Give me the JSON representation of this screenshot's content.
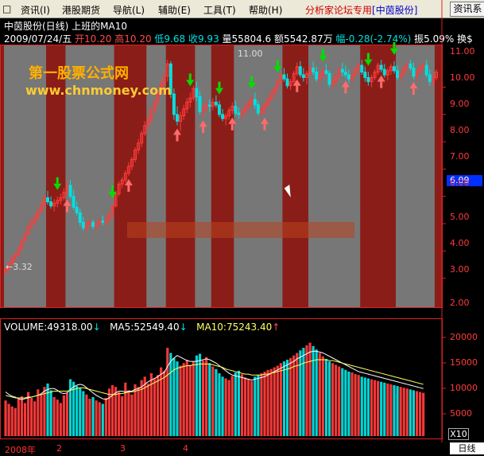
{
  "menu": {
    "items": [
      {
        "label": "资讯(I)"
      },
      {
        "label": "港股期货"
      },
      {
        "label": "导航(L)"
      },
      {
        "label": "辅助(E)"
      },
      {
        "label": "工具(T)"
      },
      {
        "label": "帮助(H)"
      }
    ],
    "promo_prefix": "分析家论坛专用",
    "promo_name": "[中茵股份]",
    "button": "资讯系"
  },
  "header": {
    "title": "中茵股份(日线) 上班的MA10",
    "date": "2009/07/24/五",
    "open_label": "开10.20",
    "high_label": "高10.20",
    "low_label": "低9.68",
    "close_label": "收9.93",
    "volume_label": "量55804.6",
    "amount_label": "额5542.87万",
    "change_label": "幅-0.28(-2.74%)",
    "amp_label": "振5.09%",
    "turnover_label": "换$"
  },
  "watermark": {
    "title": "第一股票公式网",
    "url": "www.chnmoney.com"
  },
  "annotations": {
    "low": "←3.32",
    "high": "11.00"
  },
  "price_axis": {
    "labels": [
      "11.00",
      "10.00",
      "9.00",
      "8.00",
      "7.00",
      "6.00",
      "5.00",
      "4.00",
      "3.00",
      "2.00"
    ],
    "current": "6.09"
  },
  "volume_axis": {
    "labels": [
      "20000",
      "15000",
      "10000",
      "5000"
    ],
    "multiplier": "X10"
  },
  "volume_legend": {
    "volume": "VOLUME:49318.00",
    "ma5": "MA5:52549.40",
    "ma10": "MA10:75243.40"
  },
  "x_axis": {
    "labels": [
      "2008年",
      "2",
      "3",
      "4"
    ]
  },
  "tab_label": "日线",
  "colors": {
    "up": "#ff3b3b",
    "down": "#00e0e0",
    "background": "#000000",
    "panel_red": "#8b1d18",
    "panel_gray": "#777777",
    "ma10": "#ffff66",
    "ma5": "#ffffff"
  },
  "chart_data": {
    "type": "candlestick",
    "price_range": [
      2.0,
      11.5
    ],
    "shaded_ranges": [
      {
        "start": 0,
        "end": 13
      },
      {
        "start": 19,
        "end": 34
      },
      {
        "start": 44,
        "end": 50
      },
      {
        "start": 59,
        "end": 64
      },
      {
        "start": 71,
        "end": 86
      },
      {
        "start": 94,
        "end": 110
      },
      {
        "start": 121,
        "end": 133
      }
    ],
    "candles": [
      [
        3.2,
        3.4,
        3.15,
        3.35
      ],
      [
        3.35,
        3.6,
        3.3,
        3.55
      ],
      [
        3.55,
        3.8,
        3.45,
        3.75
      ],
      [
        3.75,
        3.95,
        3.6,
        3.85
      ],
      [
        3.85,
        4.2,
        3.8,
        4.1
      ],
      [
        4.1,
        4.45,
        4.05,
        4.4
      ],
      [
        4.4,
        4.7,
        4.3,
        4.6
      ],
      [
        4.6,
        4.95,
        4.55,
        4.9
      ],
      [
        4.9,
        5.2,
        4.8,
        5.05
      ],
      [
        5.05,
        5.35,
        4.95,
        5.25
      ],
      [
        5.25,
        5.55,
        5.1,
        5.45
      ],
      [
        5.45,
        5.8,
        5.35,
        5.7
      ],
      [
        5.7,
        6.1,
        5.55,
        5.95
      ],
      [
        5.95,
        6.2,
        5.7,
        5.8
      ],
      [
        5.8,
        6.0,
        5.55,
        5.65
      ],
      [
        5.65,
        5.9,
        5.45,
        5.75
      ],
      [
        5.75,
        6.0,
        5.6,
        5.85
      ],
      [
        5.85,
        6.1,
        5.7,
        5.95
      ],
      [
        5.95,
        6.3,
        5.85,
        6.15
      ],
      [
        6.15,
        6.55,
        6.0,
        6.4
      ],
      [
        6.4,
        6.6,
        5.9,
        6.0
      ],
      [
        6.0,
        6.25,
        5.5,
        5.6
      ],
      [
        5.6,
        5.8,
        5.3,
        5.4
      ],
      [
        5.4,
        5.55,
        4.9,
        5.05
      ],
      [
        5.05,
        5.25,
        4.75,
        4.85
      ],
      [
        4.85,
        5.1,
        4.7,
        5.0
      ],
      [
        5.0,
        5.2,
        4.85,
        5.05
      ],
      [
        5.05,
        5.15,
        4.8,
        4.9
      ],
      [
        4.9,
        5.1,
        4.7,
        5.0
      ],
      [
        5.0,
        5.2,
        4.9,
        5.1
      ],
      [
        5.1,
        5.3,
        4.95,
        5.05
      ],
      [
        5.05,
        5.25,
        4.9,
        5.15
      ],
      [
        5.15,
        5.45,
        5.05,
        5.35
      ],
      [
        5.35,
        5.7,
        5.25,
        5.65
      ],
      [
        5.65,
        6.2,
        5.6,
        6.1
      ],
      [
        6.1,
        6.55,
        6.0,
        6.45
      ],
      [
        6.45,
        6.7,
        6.3,
        6.6
      ],
      [
        6.6,
        6.95,
        6.5,
        6.85
      ],
      [
        6.85,
        7.25,
        6.75,
        7.1
      ],
      [
        7.1,
        7.45,
        6.95,
        7.35
      ],
      [
        7.35,
        7.8,
        7.25,
        7.7
      ],
      [
        7.7,
        8.1,
        7.55,
        7.95
      ],
      [
        7.95,
        8.4,
        7.8,
        8.3
      ],
      [
        8.3,
        8.75,
        8.2,
        8.6
      ],
      [
        8.6,
        9.0,
        8.45,
        8.8
      ],
      [
        8.8,
        9.25,
        8.7,
        9.15
      ],
      [
        9.15,
        9.55,
        9.05,
        9.45
      ],
      [
        9.45,
        9.9,
        9.35,
        9.8
      ],
      [
        9.8,
        10.25,
        9.7,
        10.1
      ],
      [
        10.1,
        10.55,
        9.95,
        10.4
      ],
      [
        10.4,
        11.0,
        10.2,
        10.85
      ],
      [
        10.85,
        10.95,
        9.6,
        9.75
      ],
      [
        9.75,
        9.95,
        8.8,
        9.0
      ],
      [
        9.0,
        9.3,
        8.6,
        8.75
      ],
      [
        8.75,
        9.1,
        8.4,
        8.95
      ],
      [
        8.95,
        9.35,
        8.8,
        9.2
      ],
      [
        9.2,
        9.6,
        9.05,
        9.45
      ],
      [
        9.45,
        9.8,
        9.25,
        9.6
      ],
      [
        9.6,
        10.05,
        9.5,
        9.95
      ],
      [
        9.95,
        10.2,
        9.5,
        9.65
      ],
      [
        9.65,
        9.85,
        9.0,
        9.1
      ],
      [
        9.1,
        9.4,
        8.9,
        9.25
      ],
      [
        9.25,
        9.5,
        9.05,
        9.35
      ],
      [
        9.35,
        9.55,
        9.1,
        9.3
      ],
      [
        9.3,
        9.6,
        9.15,
        9.45
      ],
      [
        9.45,
        9.7,
        9.25,
        9.35
      ],
      [
        9.35,
        9.5,
        8.9,
        9.0
      ],
      [
        9.0,
        9.2,
        8.75,
        8.85
      ],
      [
        8.85,
        9.05,
        8.6,
        8.95
      ],
      [
        8.95,
        9.25,
        8.8,
        9.15
      ],
      [
        9.15,
        9.45,
        9.0,
        9.3
      ],
      [
        9.3,
        9.5,
        8.95,
        9.05
      ],
      [
        9.05,
        9.25,
        8.85,
        9.0
      ],
      [
        9.0,
        9.2,
        8.8,
        9.1
      ],
      [
        9.1,
        9.4,
        9.0,
        9.25
      ],
      [
        9.25,
        9.55,
        9.15,
        9.45
      ],
      [
        9.45,
        9.7,
        9.3,
        9.55
      ],
      [
        9.55,
        9.8,
        9.2,
        9.35
      ],
      [
        9.35,
        9.5,
        8.95,
        9.05
      ],
      [
        9.05,
        9.3,
        8.9,
        9.2
      ],
      [
        9.2,
        9.45,
        9.0,
        9.35
      ],
      [
        9.35,
        9.65,
        9.2,
        9.55
      ],
      [
        9.55,
        9.85,
        9.45,
        9.75
      ],
      [
        9.75,
        10.05,
        9.6,
        9.95
      ],
      [
        9.95,
        10.3,
        9.85,
        10.2
      ],
      [
        10.2,
        10.55,
        10.1,
        10.45
      ],
      [
        10.45,
        10.7,
        10.2,
        10.3
      ],
      [
        10.3,
        10.5,
        9.95,
        10.05
      ],
      [
        10.05,
        10.3,
        9.9,
        10.2
      ],
      [
        10.2,
        10.6,
        10.1,
        10.5
      ],
      [
        10.5,
        10.9,
        10.4,
        10.75
      ],
      [
        10.75,
        10.95,
        10.35,
        10.45
      ],
      [
        10.45,
        10.7,
        10.2,
        10.35
      ],
      [
        10.35,
        10.6,
        10.1,
        10.5
      ],
      [
        10.5,
        10.8,
        10.4,
        10.7
      ],
      [
        10.7,
        10.95,
        10.45,
        10.55
      ],
      [
        10.55,
        10.75,
        10.2,
        10.3
      ],
      [
        10.3,
        10.55,
        10.1,
        10.45
      ],
      [
        10.45,
        10.7,
        10.3,
        10.6
      ],
      [
        10.6,
        10.85,
        10.45,
        10.5
      ],
      [
        10.5,
        10.6,
        10.0,
        10.1
      ],
      [
        10.1,
        10.35,
        9.95,
        10.2
      ],
      [
        10.2,
        10.5,
        10.05,
        10.4
      ],
      [
        10.4,
        10.75,
        10.3,
        10.65
      ],
      [
        10.65,
        10.9,
        10.4,
        10.55
      ],
      [
        10.55,
        10.8,
        10.35,
        10.45
      ],
      [
        10.45,
        10.65,
        10.15,
        10.3
      ],
      [
        10.3,
        10.55,
        10.1,
        10.45
      ],
      [
        10.45,
        10.75,
        10.35,
        10.65
      ],
      [
        10.65,
        10.9,
        10.5,
        10.8
      ],
      [
        10.8,
        11.0,
        10.45,
        10.55
      ],
      [
        10.55,
        10.75,
        10.2,
        10.35
      ],
      [
        10.35,
        10.55,
        10.05,
        10.2
      ],
      [
        10.2,
        10.45,
        10.0,
        10.35
      ],
      [
        10.35,
        10.65,
        10.25,
        10.55
      ],
      [
        10.55,
        10.9,
        10.45,
        10.8
      ],
      [
        10.8,
        11.0,
        10.55,
        10.65
      ],
      [
        10.65,
        10.85,
        10.35,
        10.45
      ],
      [
        10.45,
        10.7,
        10.25,
        10.6
      ],
      [
        10.6,
        10.85,
        10.45,
        10.75
      ],
      [
        10.75,
        10.95,
        10.5,
        10.6
      ],
      [
        10.6,
        10.8,
        10.25,
        10.35
      ],
      [
        10.35,
        10.6,
        10.2,
        10.5
      ],
      [
        10.5,
        10.8,
        10.4,
        10.7
      ],
      [
        10.7,
        10.95,
        10.55,
        10.85
      ],
      [
        10.85,
        11.0,
        10.6,
        10.7
      ],
      [
        10.7,
        10.9,
        10.3,
        10.4
      ],
      [
        10.4,
        10.65,
        10.2,
        10.55
      ],
      [
        10.55,
        10.85,
        10.45,
        10.75
      ],
      [
        10.75,
        10.95,
        10.6,
        10.8
      ],
      [
        10.8,
        11.0,
        10.35,
        10.45
      ],
      [
        10.45,
        10.65,
        10.05,
        10.2
      ],
      [
        10.2,
        10.5,
        10.0,
        10.35
      ],
      [
        10.35,
        10.65,
        10.25,
        10.55
      ]
    ],
    "volumes": [
      42,
      38,
      35,
      33,
      44,
      47,
      39,
      52,
      45,
      41,
      55,
      49,
      58,
      62,
      54,
      46,
      43,
      39,
      48,
      51,
      67,
      64,
      59,
      57,
      53,
      49,
      44,
      46,
      42,
      40,
      38,
      45,
      56,
      60,
      58,
      52,
      47,
      63,
      54,
      49,
      61,
      58,
      66,
      70,
      62,
      74,
      68,
      72,
      81,
      77,
      104,
      98,
      92,
      88,
      83,
      86,
      90,
      84,
      88,
      95,
      97,
      89,
      93,
      86,
      82,
      79,
      74,
      70,
      68,
      66,
      71,
      75,
      77,
      73,
      69,
      67,
      65,
      70,
      72,
      74,
      76,
      78,
      79,
      81,
      83,
      86,
      88,
      90,
      92,
      95,
      98,
      101,
      104,
      107,
      110,
      106,
      102,
      98,
      94,
      91,
      88,
      86,
      84,
      82,
      80,
      78,
      76,
      75,
      73,
      72,
      70,
      69,
      68,
      67,
      66,
      65,
      64,
      63,
      62,
      61,
      60,
      59,
      58,
      57,
      56,
      55,
      54,
      53,
      52,
      51
    ],
    "ma5": [
      52,
      49,
      47,
      46,
      44,
      43,
      44,
      45,
      46,
      47,
      48,
      50,
      53,
      55,
      56,
      56,
      54,
      51,
      50,
      51,
      55,
      58,
      60,
      61,
      60,
      57,
      54,
      51,
      48,
      46,
      44,
      43,
      45,
      48,
      51,
      53,
      53,
      52,
      53,
      53,
      55,
      56,
      58,
      61,
      64,
      66,
      68,
      70,
      73,
      75,
      82,
      88,
      92,
      95,
      93,
      91,
      89,
      88,
      88,
      88,
      89,
      90,
      91,
      90,
      88,
      86,
      83,
      80,
      77,
      74,
      72,
      71,
      70,
      69,
      68,
      67,
      66,
      67,
      68,
      69,
      70,
      72,
      74,
      76,
      78,
      80,
      82,
      84,
      86,
      88,
      91,
      93,
      95,
      97,
      99,
      100,
      100,
      99,
      98,
      96,
      94,
      92,
      90,
      88,
      86,
      84,
      82,
      80,
      78,
      76,
      75,
      74,
      73,
      72,
      71,
      70,
      69,
      68,
      67,
      66,
      65,
      64,
      63,
      62,
      61,
      60,
      59,
      58,
      57,
      56
    ],
    "ma10": [
      48,
      47,
      46,
      45,
      45,
      45,
      45,
      46,
      46,
      47,
      48,
      49,
      50,
      51,
      52,
      53,
      53,
      53,
      53,
      53,
      54,
      55,
      56,
      57,
      57,
      56,
      55,
      54,
      53,
      52,
      51,
      50,
      49,
      49,
      49,
      50,
      50,
      51,
      52,
      52,
      53,
      54,
      55,
      57,
      59,
      61,
      63,
      65,
      67,
      69,
      72,
      75,
      78,
      80,
      81,
      82,
      83,
      83,
      84,
      84,
      85,
      85,
      85,
      85,
      84,
      83,
      82,
      81,
      79,
      78,
      77,
      76,
      75,
      74,
      73,
      73,
      72,
      72,
      72,
      72,
      73,
      73,
      74,
      75,
      76,
      77,
      78,
      79,
      80,
      82,
      83,
      84,
      86,
      87,
      88,
      89,
      90,
      90,
      90,
      90,
      89,
      89,
      88,
      87,
      86,
      85,
      84,
      83,
      82,
      81,
      80,
      79,
      78,
      77,
      76,
      75,
      74,
      73,
      72,
      71,
      70,
      69,
      68,
      67,
      66,
      65,
      64,
      63,
      62,
      61
    ],
    "signals": [
      {
        "index": 16,
        "type": "buy"
      },
      {
        "index": 19,
        "type": "sell"
      },
      {
        "index": 33,
        "type": "buy"
      },
      {
        "index": 38,
        "type": "sell"
      },
      {
        "index": 53,
        "type": "sell"
      },
      {
        "index": 57,
        "type": "buy"
      },
      {
        "index": 61,
        "type": "sell"
      },
      {
        "index": 66,
        "type": "buy"
      },
      {
        "index": 70,
        "type": "sell"
      },
      {
        "index": 76,
        "type": "buy"
      },
      {
        "index": 80,
        "type": "sell"
      },
      {
        "index": 84,
        "type": "buy"
      },
      {
        "index": 90,
        "type": "sell"
      },
      {
        "index": 98,
        "type": "buy"
      },
      {
        "index": 105,
        "type": "sell"
      },
      {
        "index": 112,
        "type": "buy"
      },
      {
        "index": 116,
        "type": "sell"
      },
      {
        "index": 120,
        "type": "buy"
      },
      {
        "index": 126,
        "type": "sell"
      }
    ]
  }
}
